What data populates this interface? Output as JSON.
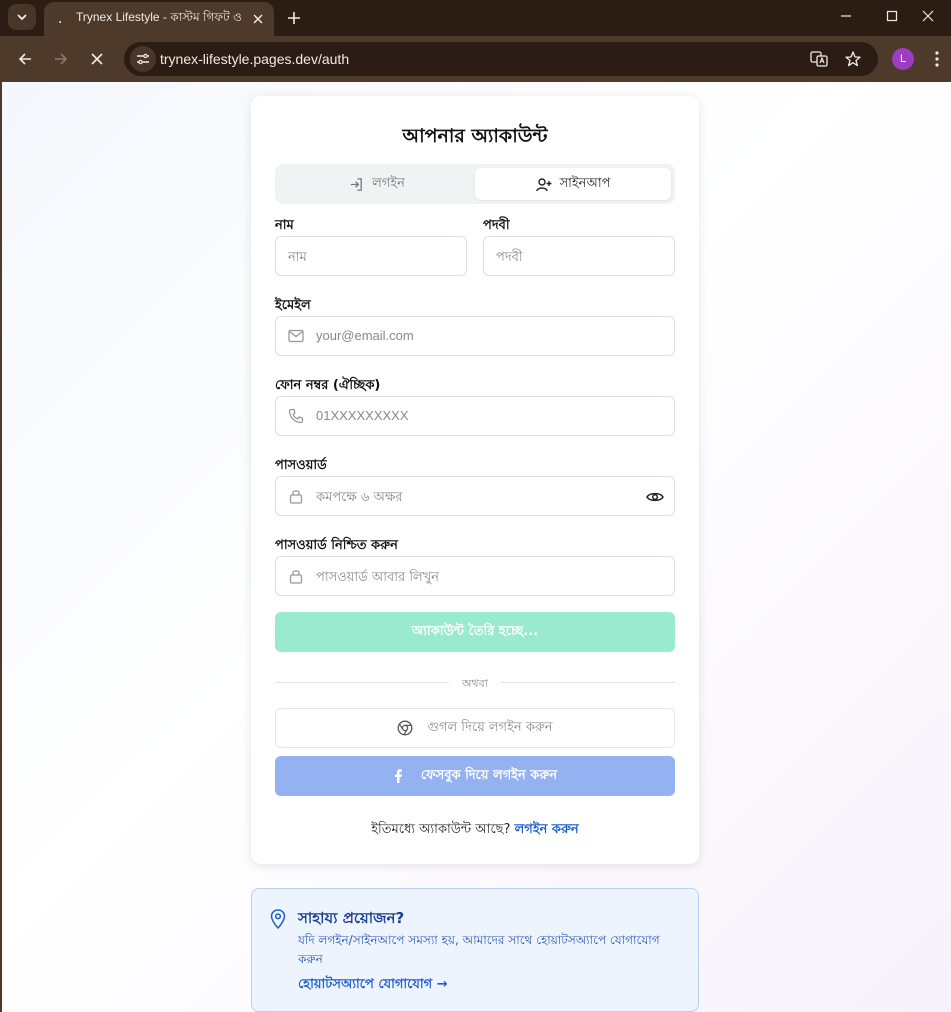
{
  "browser": {
    "tab_favicon": ".",
    "tab_title": "Trynex Lifestyle - কাস্টম গিফট ও",
    "url": "trynex-lifestyle.pages.dev/auth",
    "profile_initial": "L"
  },
  "auth": {
    "title": "আপনার অ্যাকাউন্ট",
    "tabs": {
      "login": "লগইন",
      "signup": "সাইনআপ"
    },
    "fields": {
      "name": {
        "label": "নাম",
        "placeholder": "নাম"
      },
      "designation": {
        "label": "পদবী",
        "placeholder": "পদবী"
      },
      "email": {
        "label": "ইমেইল",
        "placeholder": "your@email.com"
      },
      "phone": {
        "label": "ফোন নম্বর (ঐচ্ছিক)",
        "placeholder": "01XXXXXXXXX"
      },
      "password": {
        "label": "পাসওয়ার্ড",
        "placeholder": "কমপক্ষে ৬ অক্ষর"
      },
      "confirm_password": {
        "label": "পাসওয়ার্ড নিশ্চিত করুন",
        "placeholder": "পাসওয়ার্ড আবার লিখুন"
      }
    },
    "submit_label": "অ্যাকাউন্ট তৈরি হচ্ছে...",
    "divider_text": "অথবা",
    "google_label": "গুগল দিয়ে লগইন করুন",
    "facebook_label": "ফেসবুক দিয়ে লগইন করুন",
    "footer_prefix": "ইতিমধ্যে অ্যাকাউন্ট আছে?",
    "footer_link": "লগইন করুন"
  },
  "help": {
    "title": "সাহায্য প্রয়োজন?",
    "text": "যদি লগইন/সাইনআপে সমস্যা হয়, আমাদের সাথে হোয়াটসঅ্যাপে যোগাযোগ করুন",
    "link": "হোয়াটসঅ্যাপে যোগাযোগ →"
  },
  "colors": {
    "submit_bg": "#9aead0",
    "facebook_bg": "#94b2f2",
    "link": "#1d5fd1",
    "help_bg": "#eef4fd"
  }
}
